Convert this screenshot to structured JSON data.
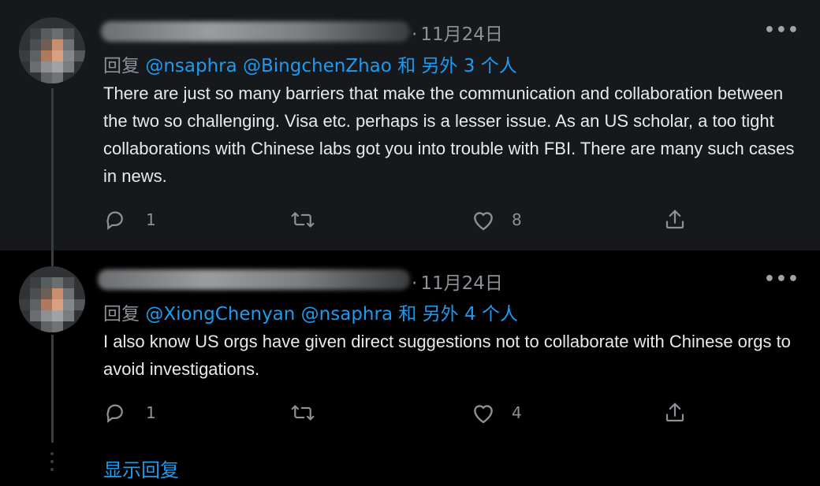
{
  "tweets": [
    {
      "date": "11月24日",
      "reply_prefix": "回复",
      "mentions": [
        "@nsaphra",
        "@BingchenZhao"
      ],
      "reply_suffix": "和 另外 3 个人",
      "text": "There are just so many barriers that make the communication and collaboration between the two so challenging. Visa etc. perhaps is a lesser issue. As an US scholar, a too tight collaborations with Chinese labs got you into trouble with FBI. There are many such cases in news.",
      "reply_count": "1",
      "retweet_count": "",
      "like_count": "8",
      "more_icon": "ellipsis-icon"
    },
    {
      "date": "11月24日",
      "reply_prefix": "回复",
      "mentions": [
        "@XiongChenyan",
        "@nsaphra"
      ],
      "reply_suffix": "和 另外 4 个人",
      "text": "I also know US orgs have given direct suggestions not to collaborate with Chinese orgs to avoid investigations.",
      "reply_count": "1",
      "retweet_count": "",
      "like_count": "4",
      "more_icon": "ellipsis-icon"
    }
  ],
  "show_replies_label": "显示回复",
  "colors": {
    "background": "#000000",
    "highlight_background": "#16181c",
    "accent": "#1d9bf0",
    "text": "#e7e9ea",
    "muted": "#8b9197"
  }
}
